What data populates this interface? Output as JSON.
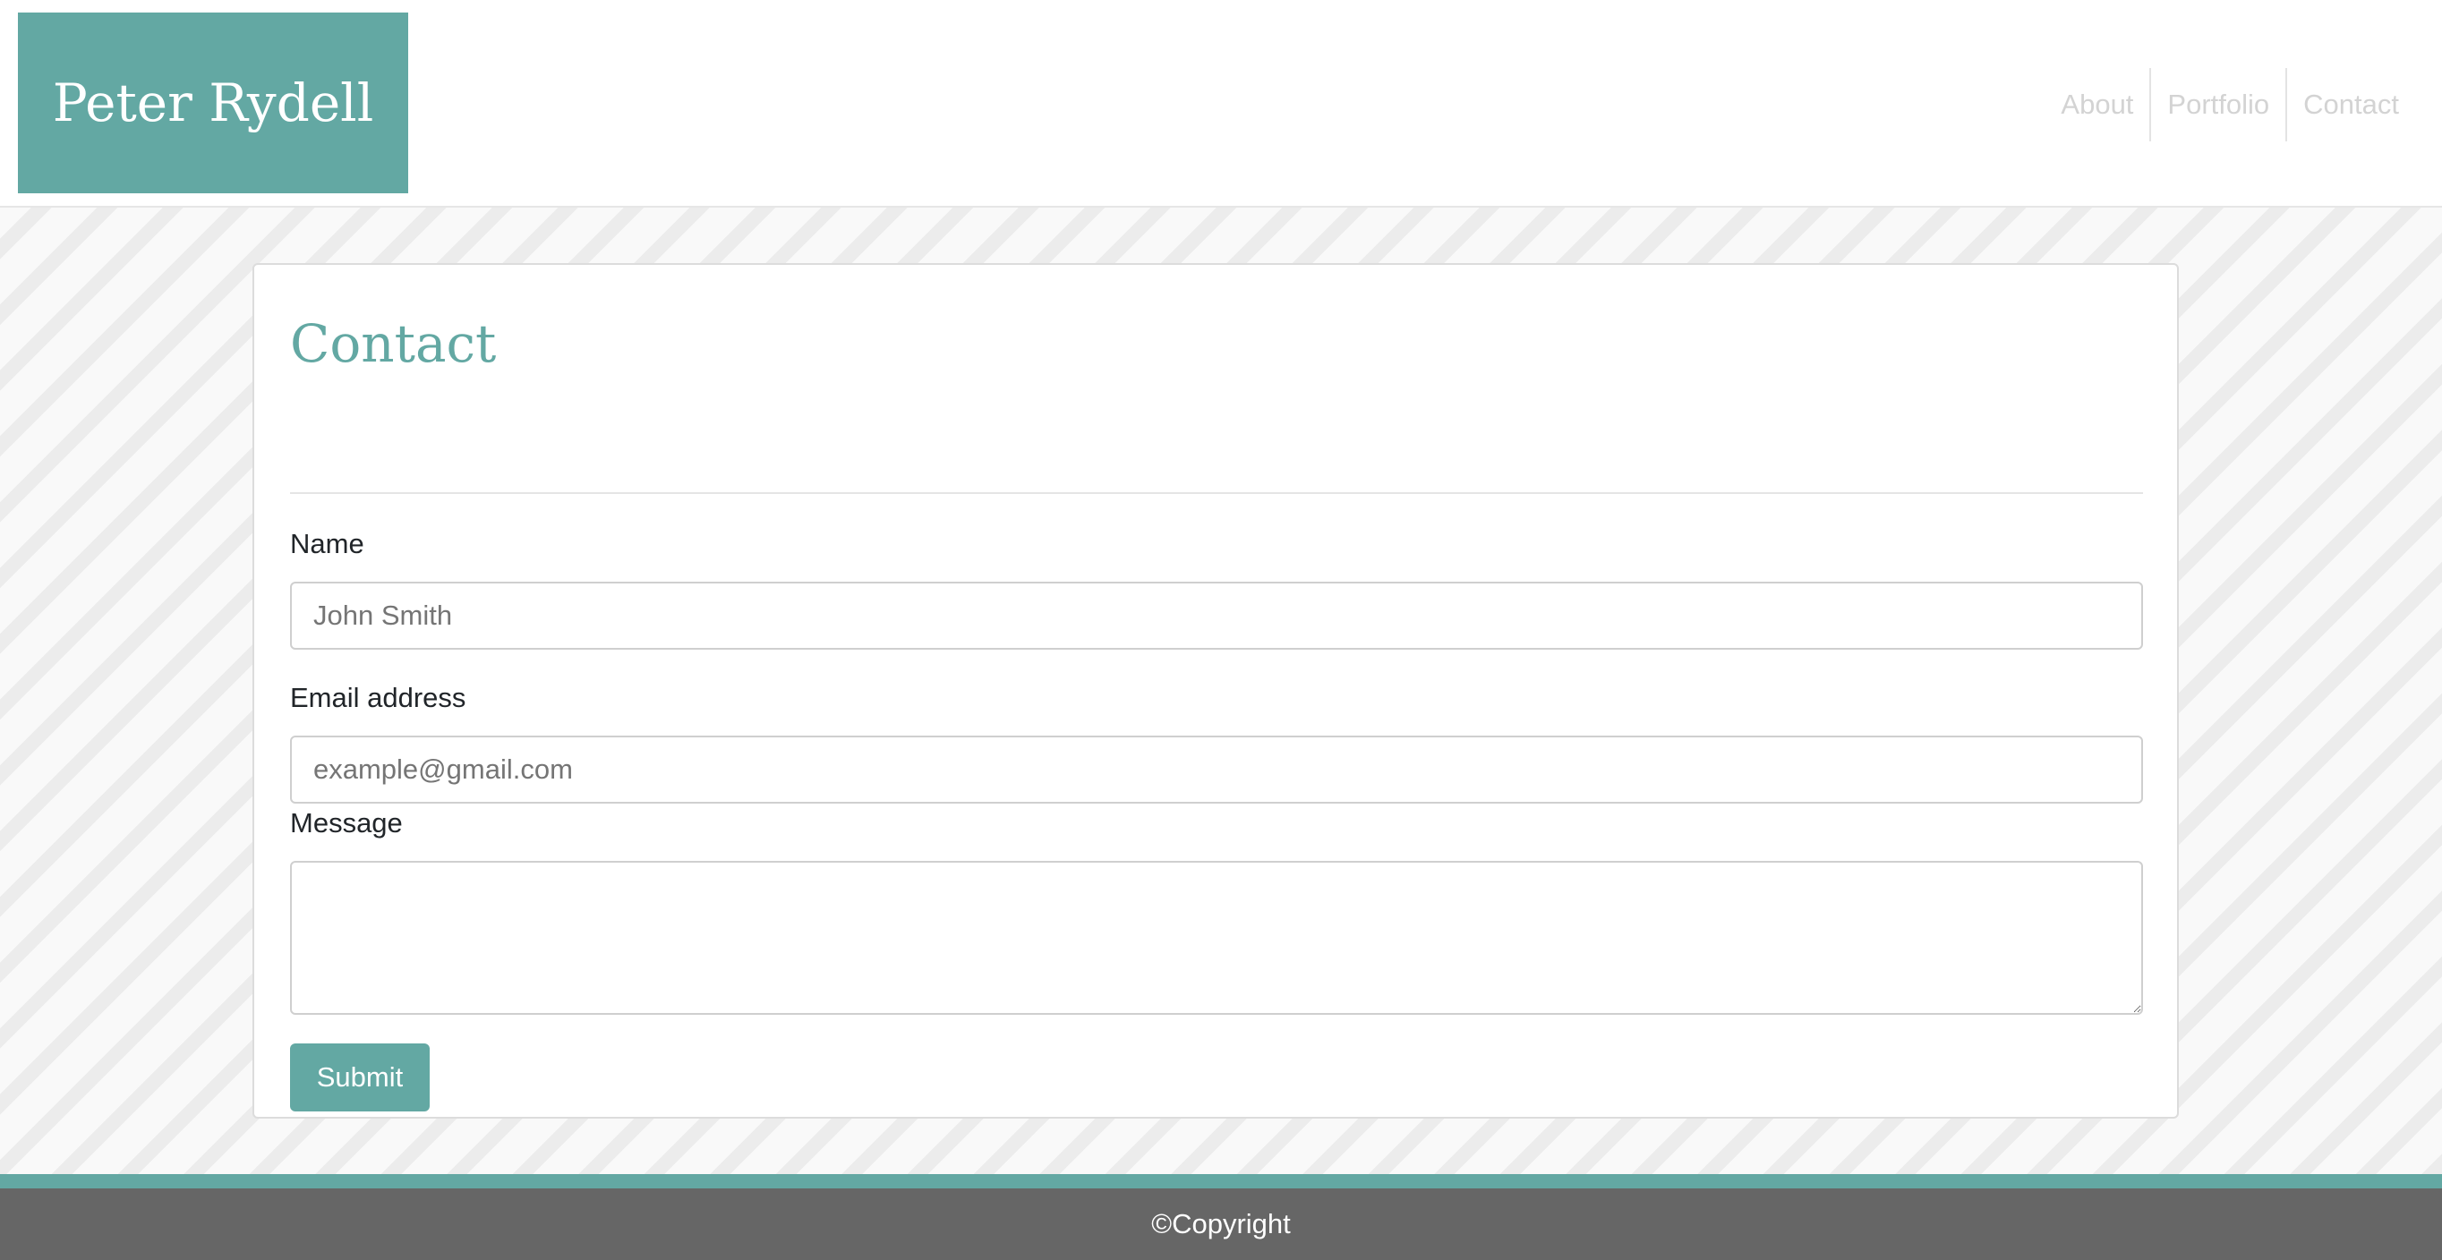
{
  "header": {
    "logo": "Peter Rydell",
    "nav": [
      {
        "label": "About"
      },
      {
        "label": "Portfolio"
      },
      {
        "label": "Contact"
      }
    ]
  },
  "contact_card": {
    "title": "Contact",
    "fields": {
      "name": {
        "label": "Name",
        "placeholder": "John Smith"
      },
      "email": {
        "label": "Email address",
        "placeholder": "example@gmail.com"
      },
      "message": {
        "label": "Message",
        "placeholder": ""
      }
    },
    "submit_label": "Submit"
  },
  "footer": {
    "copyright": "©Copyright"
  },
  "colors": {
    "accent": "#63a8a3",
    "footer_bg": "#666666",
    "nav_text": "#d3d3d3"
  }
}
